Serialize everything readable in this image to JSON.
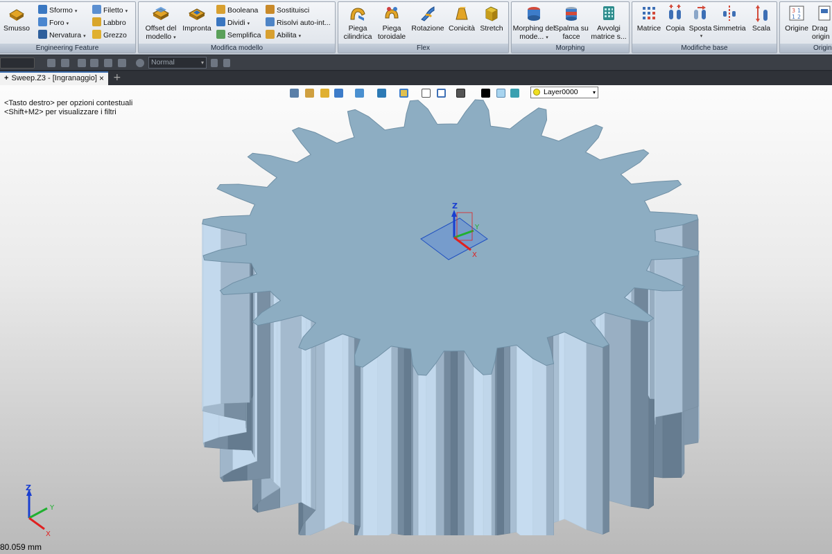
{
  "ribbon": {
    "groups": [
      {
        "title": "Engineering Feature",
        "big": [
          {
            "label": "Smusso",
            "icon": "chamfer-icon"
          }
        ],
        "small": [
          {
            "label": "Sformo",
            "dd": true
          },
          {
            "label": "Foro",
            "dd": true
          },
          {
            "label": "Nervatura",
            "dd": true
          },
          {
            "label": "Filetto",
            "dd": true
          },
          {
            "label": "Labbro",
            "dd": false
          },
          {
            "label": "Grezzo",
            "dd": false
          }
        ]
      },
      {
        "title": "Modifica modello",
        "big": [
          {
            "label": "Offset del modello",
            "icon": "offset-icon"
          },
          {
            "label": "Impronta",
            "icon": "imprint-icon"
          }
        ],
        "small": [
          {
            "label": "Booleana"
          },
          {
            "label": "Dividi"
          },
          {
            "label": "Semplifica"
          },
          {
            "label": "Sostituisci"
          },
          {
            "label": "Risolvi auto-int..."
          },
          {
            "label": "Abilita"
          }
        ]
      },
      {
        "title": "Flex",
        "big": [
          {
            "label": "Piega cilindrica",
            "icon": "cylindrical-bend-icon"
          },
          {
            "label": "Piega toroidale",
            "icon": "toroidal-bend-icon"
          },
          {
            "label": "Rotazione",
            "icon": "twist-icon"
          },
          {
            "label": "Conicità",
            "icon": "taper-icon"
          },
          {
            "label": "Stretch",
            "icon": "stretch-icon"
          }
        ]
      },
      {
        "title": "Morphing",
        "big": [
          {
            "label": "Morphing del mode...",
            "icon": "morph-icon"
          },
          {
            "label": "Spalma su facce",
            "icon": "wrap-icon"
          },
          {
            "label": "Avvolgi matrice s...",
            "icon": "wrap-pattern-icon"
          }
        ]
      },
      {
        "title": "Modifiche base",
        "big": [
          {
            "label": "Matrice",
            "icon": "pattern-icon"
          },
          {
            "label": "Copia",
            "icon": "copy-icon"
          },
          {
            "label": "Sposta",
            "icon": "move-icon"
          },
          {
            "label": "Simmetria",
            "icon": "mirror-icon"
          },
          {
            "label": "Scala",
            "icon": "scale-icon"
          }
        ]
      },
      {
        "title": "Origin",
        "big": [
          {
            "label": "Origine",
            "icon": "origin-icon"
          },
          {
            "label": "Drag origin",
            "icon": "drag-origin-icon"
          }
        ]
      }
    ]
  },
  "toolbar": {
    "mode_value": "Normal"
  },
  "document_tab": {
    "label": "Sweep.Z3 - [Ingranaggio]",
    "close": "×",
    "add": "+"
  },
  "hints": [
    "<Tasto destro> per opzioni contestuali",
    "<Shift+M2> per visualizzare i filtri"
  ],
  "layer": {
    "label": "Layer0000"
  },
  "triad": {
    "x": "X",
    "y": "Y",
    "z": "Z"
  },
  "status": {
    "measure": "80.059 mm"
  },
  "gear": {
    "teeth": 24,
    "face_color": "#8dadc2",
    "side_color": "#a9c3d4"
  }
}
